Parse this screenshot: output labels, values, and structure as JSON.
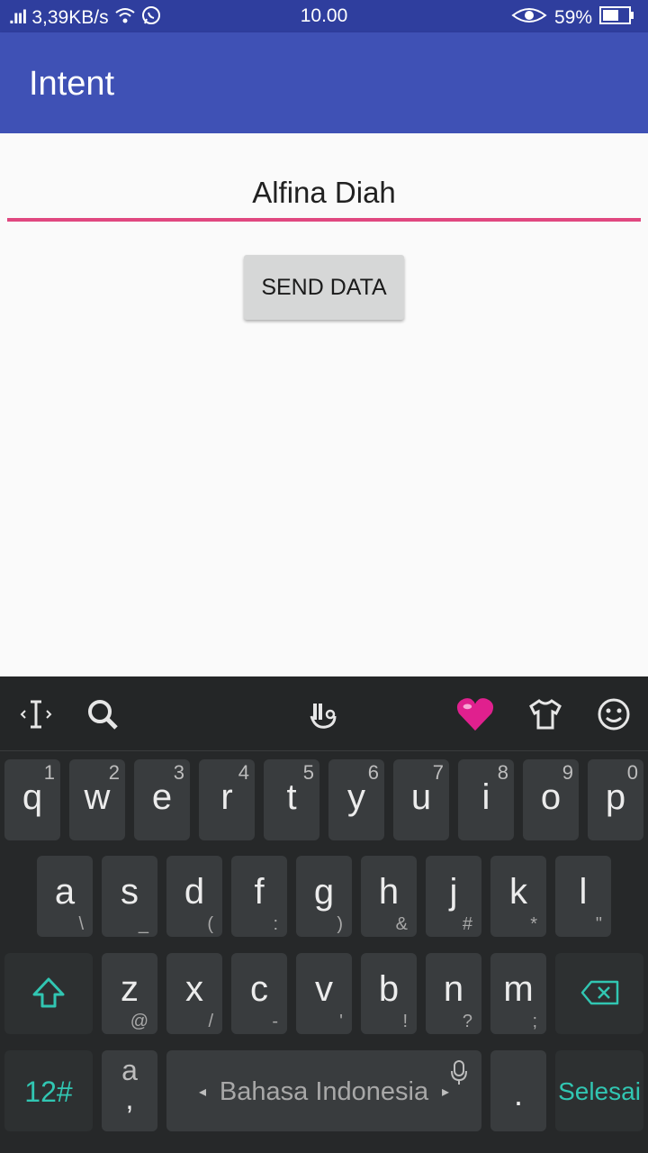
{
  "status": {
    "network": ".ııl",
    "speed": "3,39KB/s",
    "time": "10.00",
    "battery": "59%"
  },
  "appbar": {
    "title": "Intent"
  },
  "form": {
    "name_value": "Alfina Diah",
    "send_label": "SEND DATA"
  },
  "keyboard": {
    "row1": [
      {
        "k": "q",
        "s": "1"
      },
      {
        "k": "w",
        "s": "2"
      },
      {
        "k": "e",
        "s": "3"
      },
      {
        "k": "r",
        "s": "4"
      },
      {
        "k": "t",
        "s": "5"
      },
      {
        "k": "y",
        "s": "6"
      },
      {
        "k": "u",
        "s": "7"
      },
      {
        "k": "i",
        "s": "8"
      },
      {
        "k": "o",
        "s": "9"
      },
      {
        "k": "p",
        "s": "0"
      }
    ],
    "row2": [
      {
        "k": "a",
        "s": "\\"
      },
      {
        "k": "s",
        "s": "_"
      },
      {
        "k": "d",
        "s": "("
      },
      {
        "k": "f",
        "s": ":"
      },
      {
        "k": "g",
        "s": ")"
      },
      {
        "k": "h",
        "s": "&"
      },
      {
        "k": "j",
        "s": "#"
      },
      {
        "k": "k",
        "s": "*"
      },
      {
        "k": "l",
        "s": "\""
      }
    ],
    "row3": [
      {
        "k": "z",
        "s": "@"
      },
      {
        "k": "x",
        "s": "/"
      },
      {
        "k": "c",
        "s": "-"
      },
      {
        "k": "v",
        "s": "'"
      },
      {
        "k": "b",
        "s": "!"
      },
      {
        "k": "n",
        "s": "?"
      },
      {
        "k": "m",
        "s": ";"
      }
    ],
    "numbers_label": "12#",
    "comma_top": "a",
    "comma_bottom": ",",
    "space_label": "Bahasa Indonesia",
    "period_label": ".",
    "done_label": "Selesai"
  },
  "colors": {
    "appbar": "#3f51b5",
    "statusbar": "#2f3e9e",
    "accent": "#e0477f",
    "keyboard": "#262829",
    "key": "#393c3e",
    "teal": "#31c6b2"
  }
}
